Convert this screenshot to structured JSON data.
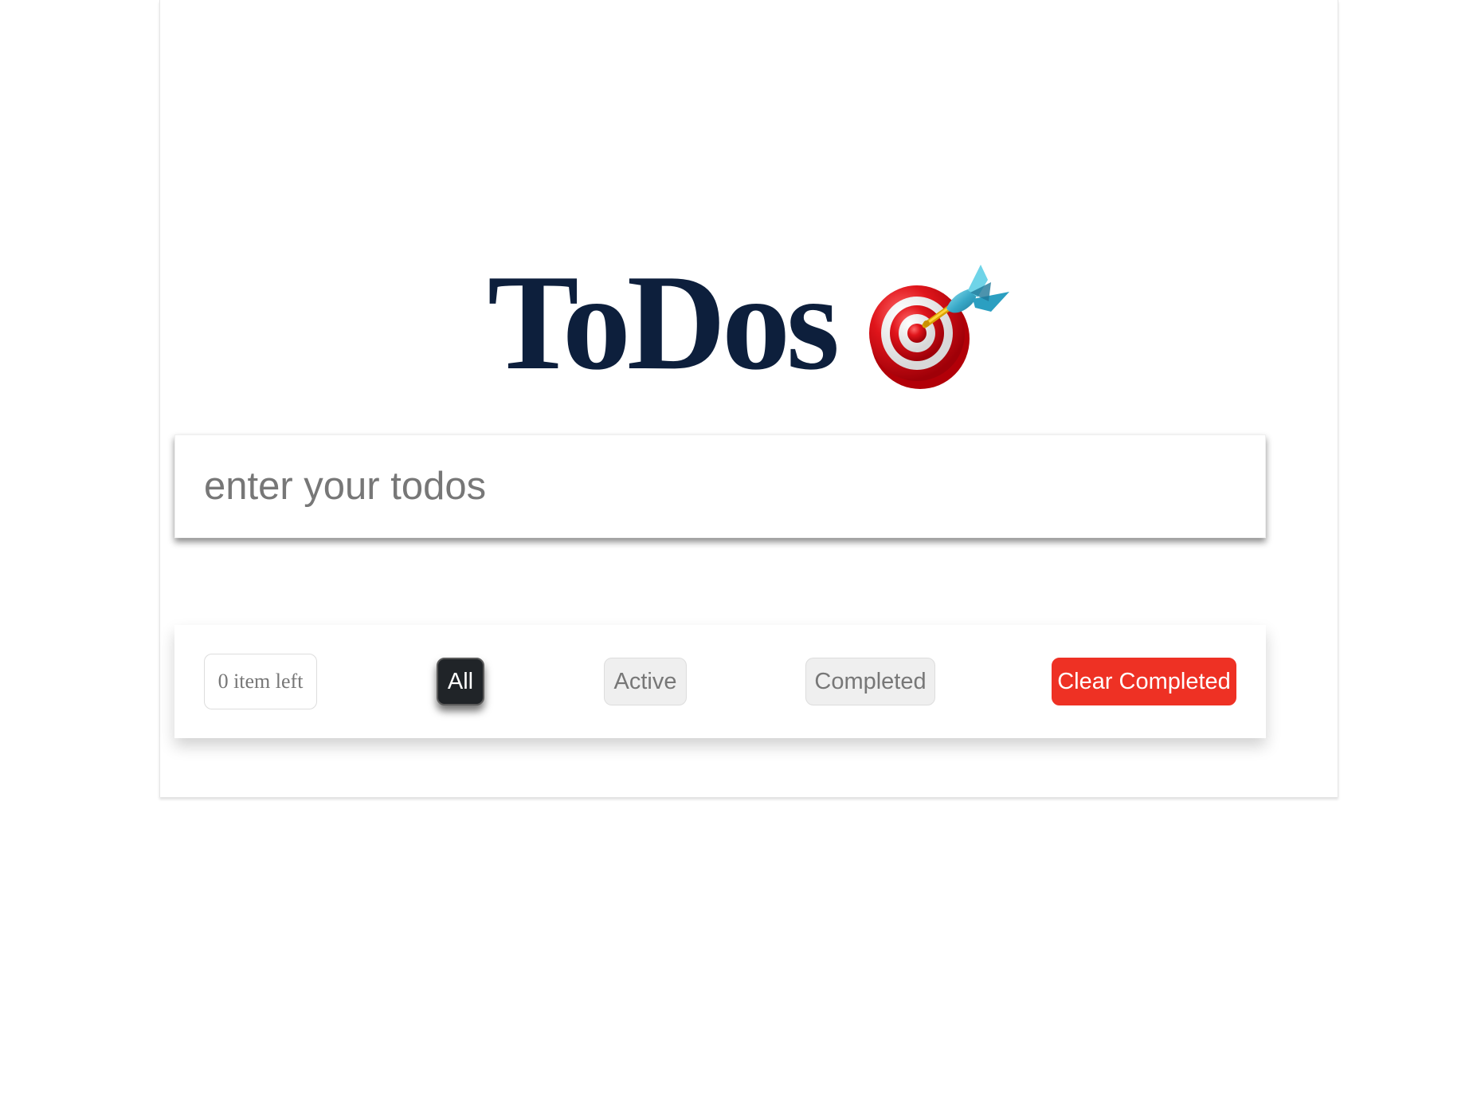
{
  "app": {
    "title": "ToDos",
    "icon": "target-icon"
  },
  "input": {
    "value": "",
    "placeholder": "enter your todos"
  },
  "footer": {
    "items_left": "0 item left",
    "filters": {
      "all": "All",
      "active": "Active",
      "completed": "Completed"
    },
    "clear_completed": "Clear Completed",
    "selected_filter": "All"
  },
  "colors": {
    "title": "#0d1f3c",
    "selected_filter": "#202428",
    "clear_completed": "#ee3124"
  }
}
